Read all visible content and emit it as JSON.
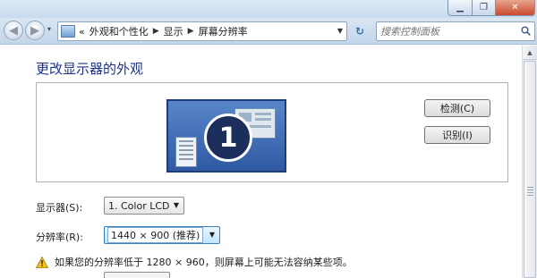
{
  "window": {
    "minimize_glyph": "▁",
    "maximize_glyph": "❐",
    "close_glyph": "✕"
  },
  "nav": {
    "back_glyph": "◀",
    "forward_glyph": "▶",
    "recent_glyph": "▾",
    "breadcrumb_prefix": "«",
    "breadcrumbs": [
      "外观和个性化",
      "显示",
      "屏幕分辨率"
    ],
    "breadcrumb_separator": "▶",
    "address_dropdown_glyph": "▼",
    "refresh_glyph": "↻",
    "search_placeholder": "搜索控制面板"
  },
  "page": {
    "title": "更改显示器的外观",
    "monitor_number": "1",
    "detect_label": "检测(C)",
    "identify_label": "识别(I)",
    "display_label": "显示器(S):",
    "display_value": "1. Color LCD",
    "resolution_label": "分辨率(R):",
    "resolution_value": "1440 × 900 (推荐)",
    "dropdown_glyph": "▼",
    "warning_text": "如果您的分辨率低于 1280 × 960，则屏幕上可能无法容纳某些项。"
  },
  "colors": {
    "title_blue": "#1e3287",
    "monitor_blue": "#2f5aa3",
    "warning_yellow": "#f2c21b"
  }
}
